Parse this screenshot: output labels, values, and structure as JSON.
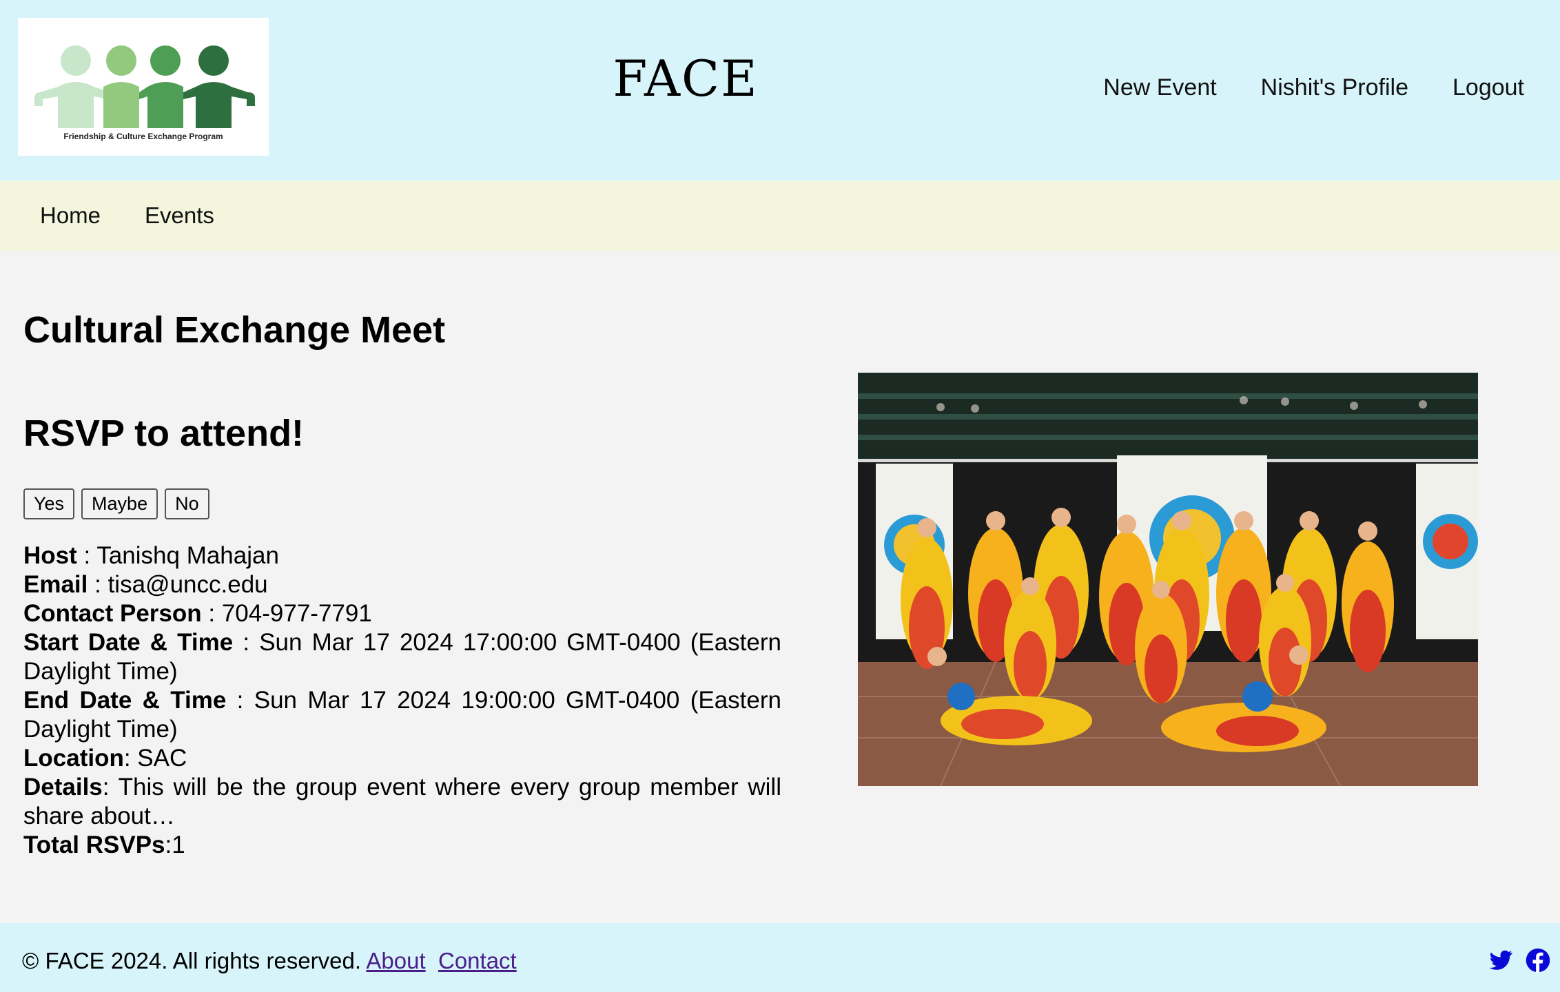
{
  "header": {
    "logo_caption": "Friendship & Culture Exchange Program",
    "site_title": "FACE",
    "nav": {
      "new_event": "New Event",
      "profile": "Nishit's Profile",
      "logout": "Logout"
    },
    "logo_colors": [
      "#c8e6c9",
      "#93c97f",
      "#4f9e55",
      "#2e6f40"
    ]
  },
  "subnav": {
    "home": "Home",
    "events": "Events"
  },
  "event": {
    "title": "Cultural Exchange Meet",
    "rsvp_heading": "RSVP to attend!",
    "rsvp_buttons": {
      "yes": "Yes",
      "maybe": "Maybe",
      "no": "No"
    },
    "fields": {
      "host_label": "Host",
      "host_value": "Tanishq Mahajan",
      "email_label": "Email",
      "email_value": "tisa@uncc.edu",
      "contact_label": "Contact Person",
      "contact_value": "704-977-7791",
      "start_label": "Start Date & Time",
      "start_value": "Sun Mar 17 2024 17:00:00 GMT-0400 (Eastern Daylight Time)",
      "end_label": "End Date & Time",
      "end_value": "Sun Mar 17 2024 19:00:00 GMT-0400 (Eastern Daylight Time)",
      "location_label": "Location",
      "location_value": "SAC",
      "details_label": "Details",
      "details_value": "This will be the group event where every group member will share about…",
      "rsvps_label": "Total RSVPs",
      "rsvps_value": "1"
    }
  },
  "footer": {
    "copyright": "© FACE 2024. All rights reserved.",
    "about": "About",
    "contact": "Contact",
    "social_icons": [
      "twitter-icon",
      "facebook-icon"
    ],
    "link_color": "#4b1e8a",
    "social_color": "#0a0ad8"
  }
}
